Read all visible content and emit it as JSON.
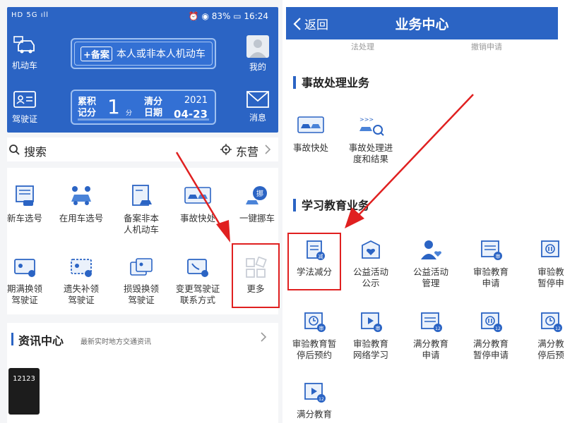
{
  "left": {
    "status_left": "HD 5G ıll",
    "status_right": "⏰ ◉ 83% ▭ 16:24",
    "side": {
      "vehicle": "机动车",
      "license": "驾驶证",
      "mine": "我的",
      "message": "消息"
    },
    "plate": {
      "tag": "+备案",
      "text": "本人或非本人机动车"
    },
    "score": {
      "label1": "累积",
      "label2": "记分",
      "value": "1",
      "unit": "分",
      "clear1": "清分",
      "clear2": "日期",
      "year": "2021",
      "date": "04-23"
    },
    "search": {
      "text": "搜索",
      "city": "东营"
    },
    "services": [
      {
        "l1": "新车选号",
        "l2": ""
      },
      {
        "l1": "在用车选号",
        "l2": ""
      },
      {
        "l1": "备案非本",
        "l2": "人机动车"
      },
      {
        "l1": "事故快处",
        "l2": ""
      },
      {
        "l1": "一键挪车",
        "l2": ""
      },
      {
        "l1": "期满换领",
        "l2": "驾驶证"
      },
      {
        "l1": "遗失补领",
        "l2": "驾驶证"
      },
      {
        "l1": "损毁换领",
        "l2": "驾驶证"
      },
      {
        "l1": "变更驾驶证",
        "l2": "联系方式"
      },
      {
        "l1": "更多",
        "l2": ""
      }
    ],
    "move_badge": "挪",
    "news": {
      "title": "资讯中心",
      "subtitle": "最新实时地方交通资讯",
      "thumb": "12123"
    }
  },
  "right": {
    "back": "返回",
    "title": "业务中心",
    "cut1": "法处理",
    "cut2": "撤销申请",
    "section1": "事故处理业务",
    "accident": [
      {
        "l1": "事故快处",
        "l2": ""
      },
      {
        "l1": "事故处理进",
        "l2": "度和结果"
      }
    ],
    "section2": "学习教育业务",
    "edu": [
      {
        "l1": "学法减分",
        "l2": ""
      },
      {
        "l1": "公益活动",
        "l2": "公示"
      },
      {
        "l1": "公益活动",
        "l2": "管理"
      },
      {
        "l1": "审验教育",
        "l2": "申请"
      },
      {
        "l1": "审验教",
        "l2": "暂停申"
      },
      {
        "l1": "审验教育暂",
        "l2": "停后预约"
      },
      {
        "l1": "审验教育",
        "l2": "网络学习"
      },
      {
        "l1": "满分教育",
        "l2": "申请"
      },
      {
        "l1": "满分教育",
        "l2": "暂停申请"
      },
      {
        "l1": "满分教",
        "l2": "停后预"
      },
      {
        "l1": "满分教育",
        "l2": ""
      }
    ],
    "badges": {
      "reduce": "减",
      "trial": "审",
      "twelve": "12"
    }
  },
  "colors": {
    "brand": "#2b64c4",
    "highlight": "#e02020"
  }
}
